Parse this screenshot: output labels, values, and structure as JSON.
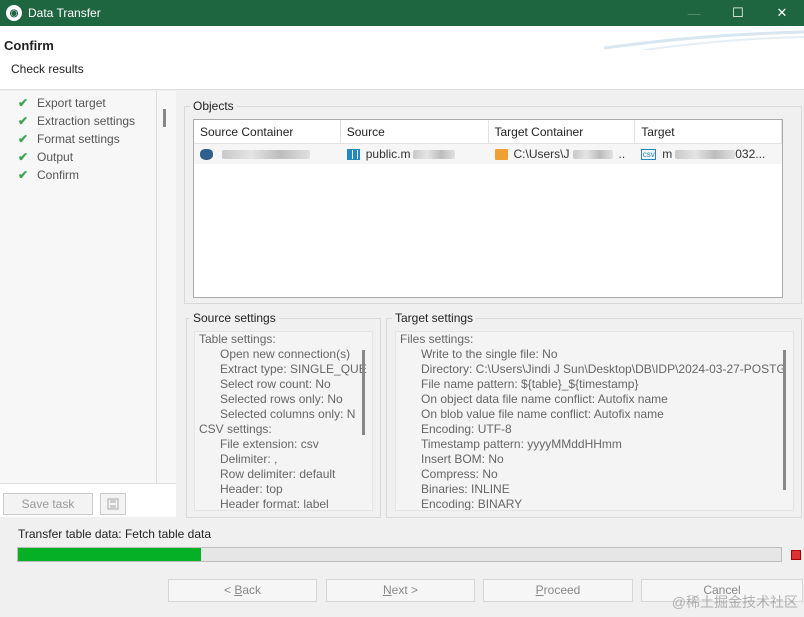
{
  "window": {
    "title": "Data Transfer"
  },
  "header": {
    "title": "Confirm",
    "subtitle": "Check results"
  },
  "nav": {
    "items": [
      {
        "label": "Export target"
      },
      {
        "label": "Extraction settings"
      },
      {
        "label": "Format settings"
      },
      {
        "label": "Output"
      },
      {
        "label": "Confirm"
      }
    ],
    "save_task_label": "Save task"
  },
  "objects": {
    "group_label": "Objects",
    "columns": [
      "Source Container",
      "Source",
      "Target Container",
      "Target"
    ],
    "rows": [
      {
        "source": "public.m",
        "target_container": "C:\\Users\\J",
        "target_container_tail": "..",
        "target_prefix": "m",
        "target_suffix": "032..."
      }
    ]
  },
  "source_settings": {
    "label": "Source settings",
    "lines": [
      {
        "text": "Table settings:",
        "level": "head"
      },
      {
        "text": "Open new connection(s)",
        "level": "sub"
      },
      {
        "text": "Extract type: SINGLE_QUE",
        "level": "sub"
      },
      {
        "text": "Select row count: No",
        "level": "sub"
      },
      {
        "text": "Selected rows only: No",
        "level": "sub"
      },
      {
        "text": "Selected columns only: N",
        "level": "sub"
      },
      {
        "text": "CSV settings:",
        "level": "head"
      },
      {
        "text": "File extension: csv",
        "level": "sub"
      },
      {
        "text": "Delimiter: ,",
        "level": "sub"
      },
      {
        "text": "Row delimiter: default",
        "level": "sub"
      },
      {
        "text": "Header: top",
        "level": "sub"
      },
      {
        "text": "Header format: label",
        "level": "sub"
      }
    ]
  },
  "target_settings": {
    "label": "Target settings",
    "lines": [
      {
        "text": "Files settings:",
        "level": "head"
      },
      {
        "text": "Write to the single file: No",
        "level": "sub"
      },
      {
        "text": "Directory: C:\\Users\\Jindi J Sun\\Desktop\\DB\\IDP\\2024-03-27-POSTG",
        "level": "sub"
      },
      {
        "text": "File name pattern: ${table}_${timestamp}",
        "level": "sub"
      },
      {
        "text": "On object data file name conflict: Autofix name",
        "level": "sub"
      },
      {
        "text": "On blob value file name conflict: Autofix name",
        "level": "sub"
      },
      {
        "text": "Encoding: UTF-8",
        "level": "sub"
      },
      {
        "text": "Timestamp pattern: yyyyMMddHHmm",
        "level": "sub"
      },
      {
        "text": "Insert BOM: No",
        "level": "sub"
      },
      {
        "text": "Compress: No",
        "level": "sub"
      },
      {
        "text": "Binaries: INLINE",
        "level": "sub"
      },
      {
        "text": "Encoding: BINARY",
        "level": "sub"
      }
    ]
  },
  "progress": {
    "label": "Transfer table data: Fetch table data",
    "fraction": 0.24
  },
  "buttons": {
    "back_mn": "B",
    "back_rest": "ack",
    "back_prefix": "< ",
    "next_mn": "N",
    "next_rest": "ext >",
    "proceed_mn": "P",
    "proceed_rest": "roceed",
    "cancel": "Cancel"
  },
  "watermark": "@稀土掘金技术社区",
  "colors": {
    "titlebar": "#1e6640",
    "progress": "#06b025",
    "check": "#3aa655"
  }
}
